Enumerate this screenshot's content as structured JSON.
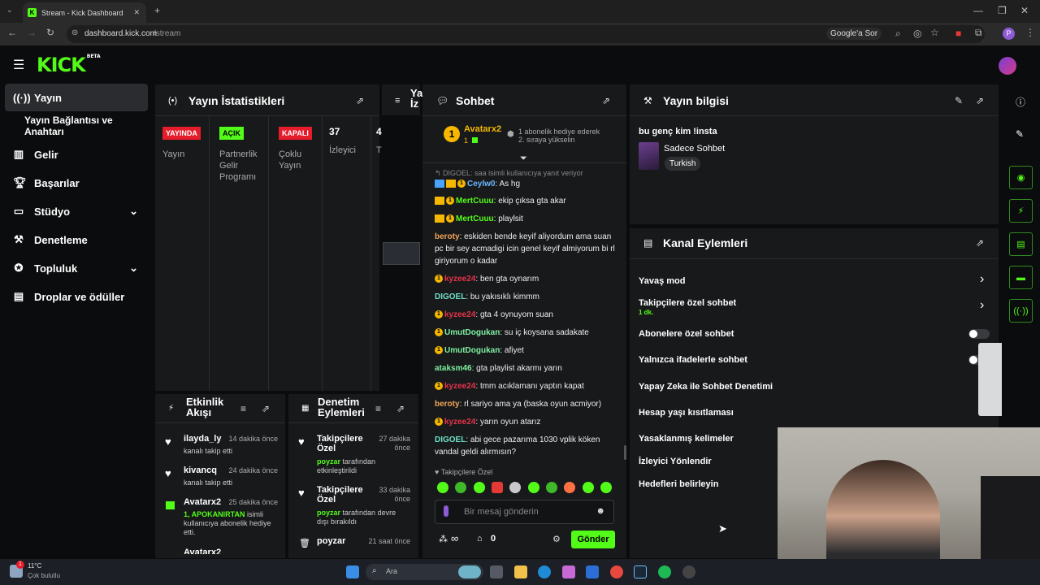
{
  "browser": {
    "tab_title": "Stream - Kick Dashboard",
    "url_host": "dashboard.kick.com",
    "url_path": "/stream",
    "google_btn": "Google'a Sor",
    "profile_letter": "P"
  },
  "kick": {
    "logo": "KICK",
    "beta": "BETA"
  },
  "sidebar": {
    "items": [
      {
        "label": "Yayın",
        "icon": "broadcast-icon"
      },
      {
        "label": "Yayın Bağlantısı ve Anahtarı"
      },
      {
        "label": "Gelir",
        "icon": "chart-icon"
      },
      {
        "label": "Başarılar",
        "icon": "trophy-icon"
      },
      {
        "label": "Stüdyo",
        "icon": "studio-icon"
      },
      {
        "label": "Denetleme",
        "icon": "wrench-icon"
      },
      {
        "label": "Topluluk",
        "icon": "community-icon"
      },
      {
        "label": "Droplar ve ödüller",
        "icon": "drops-icon"
      }
    ]
  },
  "stats": {
    "title": "Yayın İstatistikleri",
    "badge_live": "YAYINDA",
    "badge_live_label": "Yayın",
    "badge_open": "AÇIK",
    "badge_open_label": "Partnerlik Gelir Programı",
    "badge_closed": "KAPALI",
    "badge_closed_label": "Çoklu Yayın",
    "viewers": "37",
    "viewers_label": "İzleyici",
    "cut_num": "4",
    "cut_lbl": "T"
  },
  "preview": {
    "title_cut": "Ya",
    "title_cut2": "İz"
  },
  "chat": {
    "title": "Sohbet",
    "top_user": "Avatarx2",
    "top_rank": "1",
    "top_count": "1",
    "gift_line1": "1 abonelik hediye ederek",
    "gift_line2": "2. sıraya yükselin",
    "reply_note": "DIGOEL: saa isimli kullanıcıya yanıt veriyor",
    "messages": [
      {
        "user": "Ceylw0",
        "text": "As hg",
        "color": "#6ab8ff"
      },
      {
        "user": "MertCuuu",
        "text": "ekip çıksa gta akar",
        "color": "#53fc18"
      },
      {
        "user": "MertCuuu",
        "text": "playlsit",
        "color": "#53fc18"
      },
      {
        "user": "beroty",
        "text": "eskiden bende keyif aliyordum ama suan pc bir sey acmadigi icin genel keyif almiyorum bi rl giriyorum o kadar",
        "color": "#f2a65a"
      },
      {
        "user": "kyzee24",
        "text": "ben gta oynarım",
        "color": "#e8334a"
      },
      {
        "user": "DIGOEL",
        "text": "bu yakısıklı kimmm",
        "color": "#6fe0c7"
      },
      {
        "user": "kyzee24",
        "text": "gta 4 oynuyom suan",
        "color": "#e8334a"
      },
      {
        "user": "UmutDogukan",
        "text": "su iç koysana sadakate",
        "color": "#7ef0a0"
      },
      {
        "user": "UmutDogukan",
        "text": "afiyet",
        "color": "#7ef0a0"
      },
      {
        "user": "ataksm46",
        "text": "gta playlist akarmı yarın",
        "color": "#7ef0a0"
      },
      {
        "user": "kyzee24",
        "text": "tmm acıklamanı yaptın kapat",
        "color": "#e8334a"
      },
      {
        "user": "beroty",
        "text": "rl sariyo ama ya (baska oyun acmiyor)",
        "color": "#f2a65a"
      },
      {
        "user": "kyzee24",
        "text": "yarın oyun atarız",
        "color": "#e8334a"
      },
      {
        "user": "DIGOEL",
        "text": "abi gece pazarıma 1030 vplik köken vandal geldi alırmısın?",
        "color": "#6fe0c7"
      }
    ],
    "mode": "Takipçilere Özel",
    "placeholder": "Bir mesaj gönderin",
    "infinity": "∞",
    "count_zero": "0",
    "send": "Gönder"
  },
  "info": {
    "title": "Yayın bilgisi",
    "stream_title": "bu genç kim !insta",
    "category": "Sadece Sohbet",
    "tag": "Turkish"
  },
  "actions": {
    "title": "Kanal Eylemleri",
    "items": [
      "Yavaş mod",
      "Takipçilere özel sohbet",
      "Abonelere özel sohbet",
      "Yalnızca ifadelerle sohbet",
      "Yapay Zeka ile Sohbet Denetimi",
      "Hesap yaşı kısıtlaması",
      "Yasaklanmış kelimeler",
      "İzleyici Yönlendir",
      "Hedefleri belirleyin"
    ],
    "follower_sub": "1 dk."
  },
  "activity": {
    "title": "Etkinlik Akışı",
    "items": [
      {
        "name": "ilayda_ly",
        "sub": "kanalı takip etti",
        "time": "14 dakika önce"
      },
      {
        "name": "kivancq",
        "sub": "kanalı takip etti",
        "time": "24 dakika önce"
      },
      {
        "name": "Avatarx2",
        "sub_hl": "1, APOKANIRTAN",
        "sub": "isimli kullanıcıya abonelik hediye etti.",
        "time": "25 dakika önce"
      },
      {
        "name": "Avatarx2",
        "time": "..."
      }
    ]
  },
  "moderation": {
    "title": "Denetim Eylemleri",
    "items": [
      {
        "name": "Takipçilere Özel",
        "who": "poyzar",
        "sub": "tarafından etkinleştirildi",
        "time": "27 dakika önce"
      },
      {
        "name": "Takipçilere Özel",
        "who": "poyzar",
        "sub": "tarafından devre dışı bırakıldı",
        "time": "33 dakika önce"
      },
      {
        "name": "poyzar",
        "time": "21 saat önce"
      }
    ]
  },
  "taskbar": {
    "temp": "11°C",
    "weather": "Çok bulutlu",
    "search": "Ara",
    "notif": "1"
  },
  "colors": {
    "accent": "#53fc18",
    "live": "#e51c2a",
    "panel": "#18191b"
  }
}
